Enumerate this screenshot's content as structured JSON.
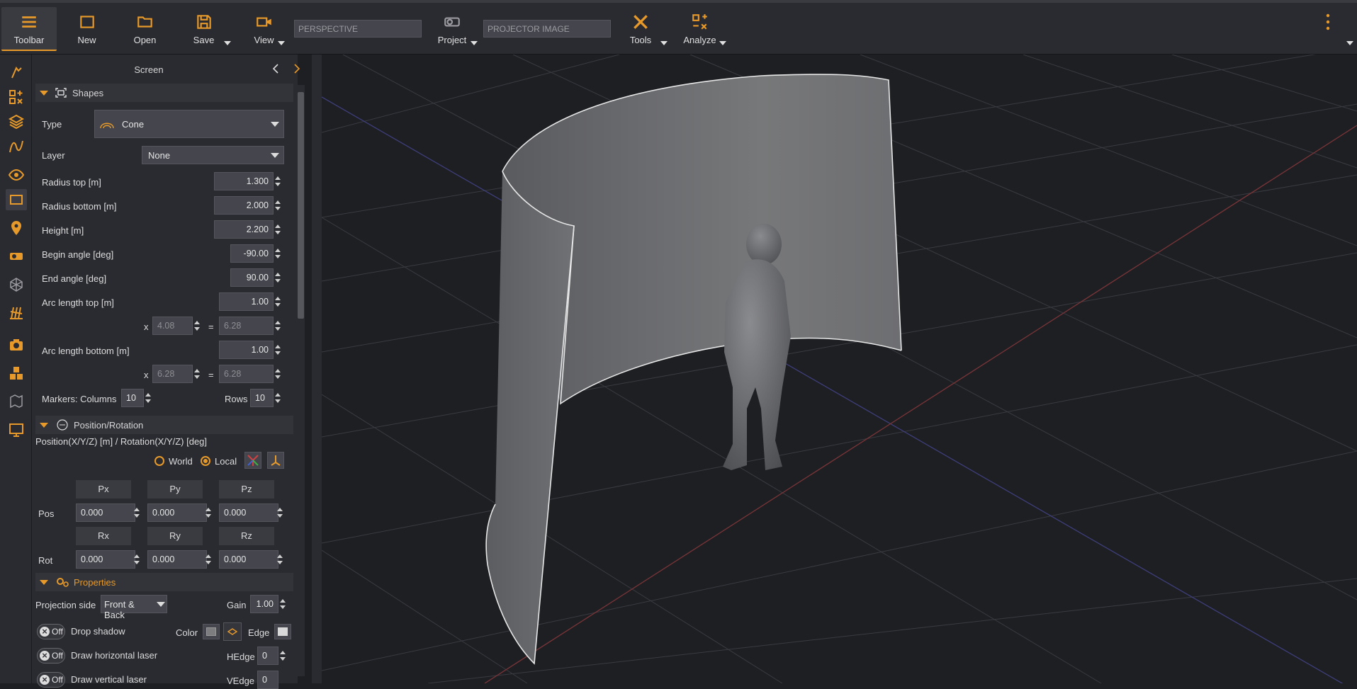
{
  "toolbar": {
    "toolbar_label": "Toolbar",
    "new_label": "New",
    "open_label": "Open",
    "save_label": "Save",
    "view_label": "View",
    "view_mode": "PERSPECTIVE",
    "project_label": "Project",
    "projector_field": "PROJECTOR IMAGE",
    "tools_label": "Tools",
    "analyze_label": "Analyze"
  },
  "sidebar": {
    "icons": [
      "pointer-icon",
      "add-objects-icon",
      "layers-icon",
      "curve-icon",
      "eye-icon",
      "screen-icon",
      "location-pin-icon",
      "projector-icon",
      "perspective-box-icon",
      "laser-icon",
      "camera-icon",
      "cubes-icon",
      "blend-icon",
      "display-icon"
    ]
  },
  "panel": {
    "title": "Screen",
    "shapes": {
      "header": "Shapes",
      "type_label": "Type",
      "type_value": "Cone",
      "layer_label": "Layer",
      "layer_value": "None",
      "radius_top_label": "Radius top  [m]",
      "radius_top": "1.300",
      "radius_bottom_label": "Radius bottom  [m]",
      "radius_bottom": "2.000",
      "height_label": "Height  [m]",
      "height": "2.200",
      "begin_angle_label": "Begin angle [deg]",
      "begin_angle": "-90.00",
      "end_angle_label": "End angle [deg]",
      "end_angle": "90.00",
      "arc_top_label": "Arc length top  [m]",
      "arc_top": "1.00",
      "arc_top_x": "4.08",
      "arc_top_eq": "6.28",
      "arc_bottom_label": "Arc length bottom  [m]",
      "arc_bottom": "1.00",
      "arc_bottom_x": "6.28",
      "arc_bottom_eq": "6.28",
      "x_sym": "x",
      "eq_sym": "=",
      "markers_label": "Markers:  Columns",
      "columns": "10",
      "rows_label": "Rows",
      "rows": "10"
    },
    "position": {
      "header": "Position/Rotation",
      "subtitle": "Position(X/Y/Z) [m] / Rotation(X/Y/Z) [deg]",
      "world_label": "World",
      "local_label": "Local",
      "px": "Px",
      "py": "Py",
      "pz": "Pz",
      "pos_label": "Pos",
      "pos": [
        "0.000",
        "0.000",
        "0.000"
      ],
      "rx": "Rx",
      "ry": "Ry",
      "rz": "Rz",
      "rot_label": "Rot",
      "rot": [
        "0.000",
        "0.000",
        "0.000"
      ]
    },
    "properties": {
      "header": "Properties",
      "projection_side_label": "Projection side",
      "projection_side": "Front & Back",
      "gain_label": "Gain",
      "gain": "1.00",
      "off": "Off",
      "drop_shadow": "Drop shadow",
      "color_label": "Color",
      "edge_label": "Edge",
      "draw_h_laser": "Draw horizontal laser",
      "hedge_label": "HEdge",
      "hedge": "0",
      "draw_v_laser": "Draw vertical laser",
      "vedge_label": "VEdge",
      "vedge": "0"
    }
  },
  "colors": {
    "accent": "#e79a2a",
    "background": "#1e1f23",
    "panel": "#2a2b30"
  }
}
